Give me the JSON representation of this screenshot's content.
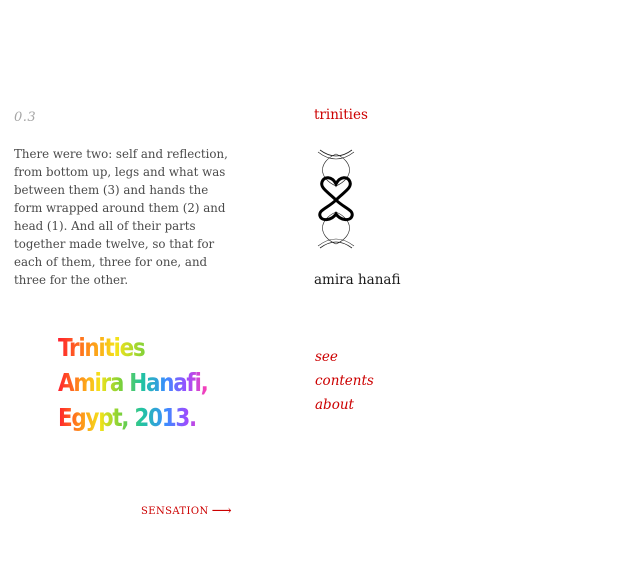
{
  "page_number": "0.3",
  "paragraph": "There were two: self and reflection, from bottom up, legs and what was between them (3) and hands the form wrapped around them (2) and head (1). And all of their parts together made twelve, so that for each of them, three for one, and three for the other.",
  "artwork": {
    "line1": "Trinities",
    "line2": "Amira Hanafi,",
    "line3": "Egypt, 2013."
  },
  "next_link": {
    "label": "SENSATION",
    "arrow": "⟶"
  },
  "sidebar": {
    "title": "trinities",
    "emblem_icon": "interlaced-figure-icon",
    "author": "amira hanafi",
    "menu": [
      "see",
      "contents",
      "about"
    ]
  },
  "colors": {
    "accent": "#cc0000",
    "text": "#4a4a4a",
    "muted": "#a6a6a6"
  }
}
